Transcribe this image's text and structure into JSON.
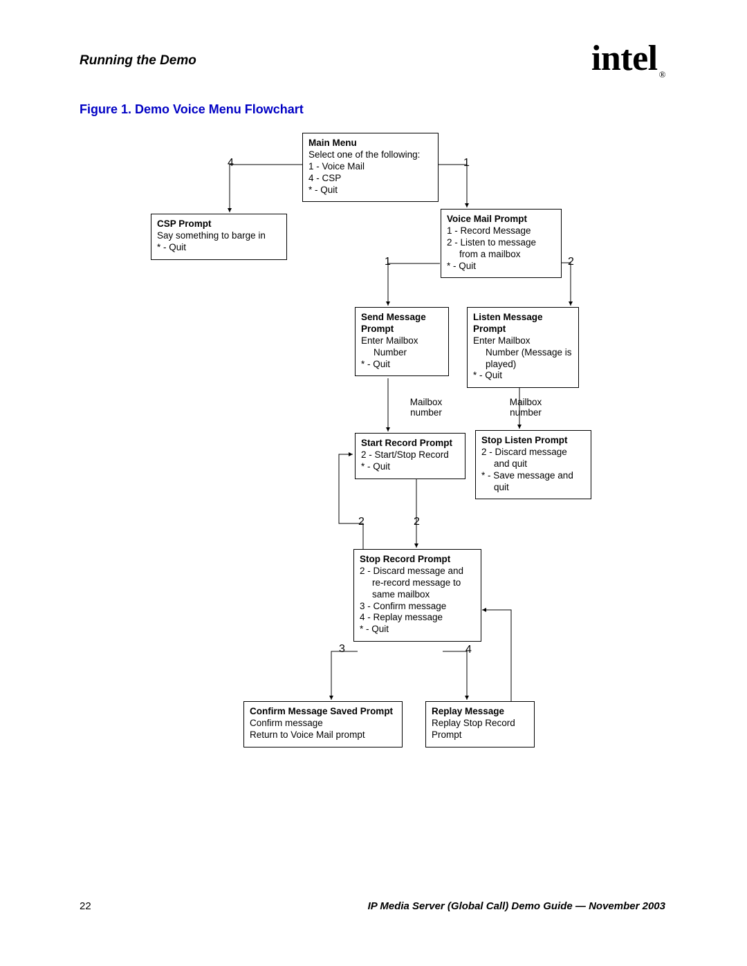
{
  "header": {
    "section": "Running the Demo",
    "brand": "intel",
    "reg": "®"
  },
  "figure_title": "Figure 1.  Demo Voice Menu Flowchart",
  "nodes": {
    "main_menu": {
      "title": "Main Menu",
      "l1": "Select one of the following:",
      "l2": "1 - Voice Mail",
      "l3": "4 - CSP",
      "l4": "* - Quit"
    },
    "csp": {
      "title": "CSP Prompt",
      "l1": "Say something to barge in",
      "l2": "* - Quit"
    },
    "vmail": {
      "title": "Voice Mail Prompt",
      "l1": "1 - Record Message",
      "l2": "2 - Listen to message",
      "l2i": "from a mailbox",
      "l3": "* - Quit"
    },
    "send": {
      "title": "Send Message Prompt",
      "l1": "Enter Mailbox",
      "l1i": "Number",
      "l2": "* - Quit"
    },
    "listen": {
      "title": "Listen Message Prompt",
      "l1": "Enter Mailbox",
      "l1i": "Number (Message is played)",
      "l2": "* - Quit"
    },
    "startrec": {
      "title": "Start Record Prompt",
      "l1": "2 - Start/Stop Record",
      "l2": "* - Quit"
    },
    "stoplisten": {
      "title": "Stop Listen Prompt",
      "l1": "2 - Discard message",
      "l1i": "and quit",
      "l2": "* - Save message and",
      "l2i": "quit"
    },
    "stoprec": {
      "title": "Stop Record Prompt",
      "l1": "2 - Discard message and",
      "l1i": "re-record message to same mailbox",
      "l2": "3 - Confirm message",
      "l3": "4 - Replay message",
      "l4": "* - Quit"
    },
    "confirm": {
      "title": "Confirm Message Saved Prompt",
      "l1": "Confirm message",
      "l2": "Return to Voice Mail prompt"
    },
    "replay": {
      "title": "Replay Message",
      "l1": "Replay Stop Record Prompt"
    }
  },
  "edge_labels": {
    "main_to_csp": "4",
    "main_to_vmail": "1",
    "vmail_to_send": "1",
    "vmail_to_listen": "2",
    "mailbox1": "Mailbox number",
    "mailbox2": "Mailbox number",
    "startrec_to_stoprec_a": "2",
    "startrec_to_stoprec_b": "2",
    "stoprec_to_confirm": "3",
    "stoprec_to_replay": "4"
  },
  "footer": {
    "page": "22",
    "text": "IP Media Server (Global Call) Demo Guide — November 2003"
  }
}
